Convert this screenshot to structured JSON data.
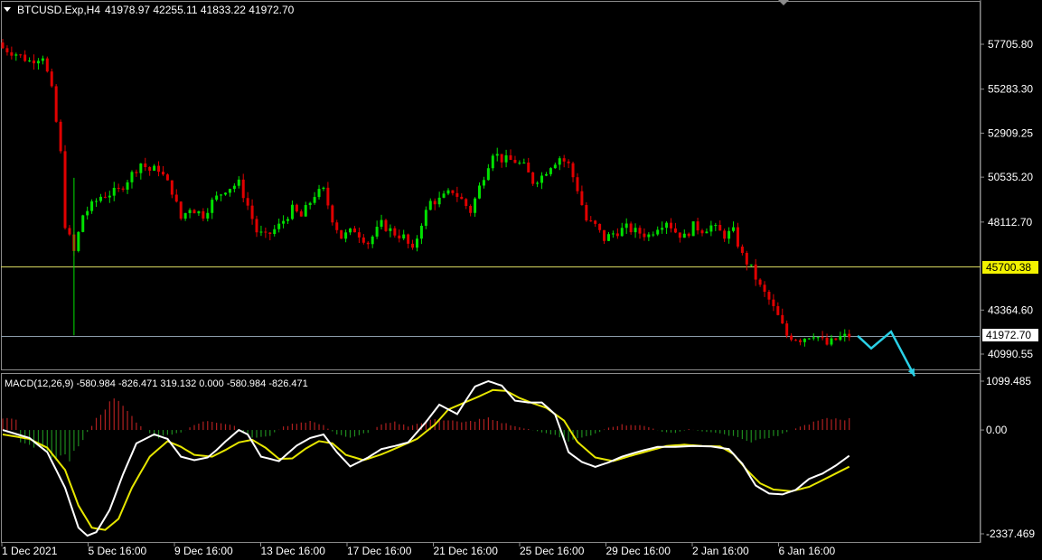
{
  "chart_title": "BTCUSD.Exp,H4",
  "ohlc_text": "41978.97 42255.11 41833.22 41972.70",
  "price_axis": {
    "labels": [
      "57705.80",
      "55283.30",
      "52909.25",
      "50535.20",
      "48112.70",
      "43364.60",
      "40990.55"
    ],
    "values": [
      57705.8,
      55283.3,
      52909.25,
      50535.2,
      48112.7,
      43364.6,
      40990.55
    ]
  },
  "macd": {
    "label": "MACD(12,26,9) -580.984 -826.471 319.132 0.000 -580.984 -826.471",
    "axis_labels": [
      "1099.485",
      "0.00",
      "-2337.469"
    ],
    "axis_values": [
      1099.485,
      0,
      -2337.469
    ]
  },
  "time_axis": [
    "1 Dec 2021",
    "5 Dec 16:00",
    "9 Dec 16:00",
    "13 Dec 16:00",
    "17 Dec 16:00",
    "21 Dec 16:00",
    "25 Dec 16:00",
    "29 Dec 16:00",
    "2 Jan 16:00",
    "6 Jan 16:00"
  ],
  "levels": {
    "support": {
      "label": "45700.38",
      "value": 45700.38,
      "color": "#d8d860"
    },
    "current": {
      "label": "41972.70",
      "value": 41972.7,
      "color": "#8a9aa8"
    }
  },
  "colors": {
    "bull": "#00e000",
    "bear": "#e00000",
    "hist_pos": "#b02020",
    "hist_neg": "#1e8a1e",
    "macd_line": "#ffffff",
    "signal_line": "#e6e600",
    "arrow": "#2ad0e6",
    "frame": "#8c8c8c"
  },
  "icons": {
    "menu": "triangle-down-icon",
    "shift": "chart-shift-icon"
  },
  "chart_data": {
    "type": "candlestick",
    "title": "BTCUSD.Exp,H4",
    "y_range": [
      40300,
      59300
    ],
    "close_path": [
      [
        0,
        57500
      ],
      [
        3,
        57200
      ],
      [
        6,
        56800
      ],
      [
        9,
        57100
      ],
      [
        11,
        55200
      ],
      [
        13,
        51800
      ],
      [
        14,
        48000
      ],
      [
        16,
        46500
      ],
      [
        18,
        48500
      ],
      [
        22,
        49500
      ],
      [
        26,
        49800
      ],
      [
        29,
        50700
      ],
      [
        31,
        51300
      ],
      [
        33,
        50900
      ],
      [
        35,
        51000
      ],
      [
        38,
        49800
      ],
      [
        40,
        48300
      ],
      [
        42,
        48900
      ],
      [
        45,
        48500
      ],
      [
        47,
        49200
      ],
      [
        50,
        49900
      ],
      [
        53,
        50200
      ],
      [
        55,
        49000
      ],
      [
        57,
        47600
      ],
      [
        59,
        47300
      ],
      [
        62,
        47900
      ],
      [
        65,
        48800
      ],
      [
        67,
        48400
      ],
      [
        70,
        49600
      ],
      [
        72,
        49800
      ],
      [
        74,
        48300
      ],
      [
        76,
        47300
      ],
      [
        79,
        47700
      ],
      [
        82,
        47000
      ],
      [
        85,
        48000
      ],
      [
        88,
        47500
      ],
      [
        90,
        47300
      ],
      [
        92,
        46500
      ],
      [
        94,
        48100
      ],
      [
        96,
        49200
      ],
      [
        98,
        49300
      ],
      [
        101,
        49800
      ],
      [
        103,
        49300
      ],
      [
        105,
        48700
      ],
      [
        107,
        50000
      ],
      [
        110,
        51900
      ],
      [
        112,
        51500
      ],
      [
        115,
        51400
      ],
      [
        117,
        51100
      ],
      [
        119,
        50300
      ],
      [
        121,
        50600
      ],
      [
        123,
        51200
      ],
      [
        125,
        51600
      ],
      [
        127,
        51200
      ],
      [
        129,
        49900
      ],
      [
        131,
        48200
      ],
      [
        133,
        47900
      ],
      [
        135,
        47200
      ],
      [
        137,
        47500
      ],
      [
        140,
        47800
      ],
      [
        142,
        47600
      ],
      [
        145,
        47400
      ],
      [
        147,
        47900
      ],
      [
        149,
        48200
      ],
      [
        151,
        47600
      ],
      [
        153,
        47300
      ],
      [
        155,
        47900
      ],
      [
        157,
        47700
      ],
      [
        159,
        47900
      ],
      [
        162,
        47400
      ],
      [
        164,
        47600
      ],
      [
        166,
        46300
      ],
      [
        168,
        45600
      ],
      [
        170,
        44600
      ],
      [
        172,
        43900
      ],
      [
        174,
        43000
      ],
      [
        176,
        42000
      ],
      [
        179,
        41800
      ],
      [
        182,
        42100
      ],
      [
        185,
        41500
      ],
      [
        188,
        41900
      ],
      [
        190,
        41972.7
      ]
    ],
    "forecast_arrow": [
      {
        "x": 0,
        "price": 41972.7
      },
      {
        "x": 1,
        "price": 41300
      },
      {
        "x": 2,
        "price": 42200
      },
      {
        "x": 3,
        "price": 39800
      }
    ],
    "macd_line": [
      [
        0,
        0
      ],
      [
        6,
        -180
      ],
      [
        10,
        -500
      ],
      [
        14,
        -1300
      ],
      [
        17,
        -2200
      ],
      [
        19,
        -2380
      ],
      [
        21,
        -2300
      ],
      [
        24,
        -1800
      ],
      [
        27,
        -1000
      ],
      [
        30,
        -300
      ],
      [
        34,
        -100
      ],
      [
        37,
        -200
      ],
      [
        40,
        -600
      ],
      [
        43,
        -680
      ],
      [
        46,
        -620
      ],
      [
        48,
        -450
      ],
      [
        50,
        -260
      ],
      [
        53,
        0
      ],
      [
        55,
        -100
      ],
      [
        58,
        -600
      ],
      [
        62,
        -700
      ],
      [
        66,
        -350
      ],
      [
        69,
        -180
      ],
      [
        72,
        -100
      ],
      [
        75,
        -500
      ],
      [
        78,
        -820
      ],
      [
        82,
        -620
      ],
      [
        85,
        -430
      ],
      [
        88,
        -360
      ],
      [
        91,
        -280
      ],
      [
        95,
        180
      ],
      [
        98,
        570
      ],
      [
        102,
        360
      ],
      [
        106,
        980
      ],
      [
        109,
        1100
      ],
      [
        112,
        1000
      ],
      [
        115,
        660
      ],
      [
        118,
        620
      ],
      [
        121,
        620
      ],
      [
        124,
        350
      ],
      [
        127,
        -500
      ],
      [
        130,
        -720
      ],
      [
        133,
        -830
      ],
      [
        136,
        -730
      ],
      [
        139,
        -600
      ],
      [
        143,
        -480
      ],
      [
        147,
        -380
      ],
      [
        151,
        -380
      ],
      [
        155,
        -360
      ],
      [
        159,
        -370
      ],
      [
        163,
        -430
      ],
      [
        166,
        -760
      ],
      [
        169,
        -1250
      ],
      [
        172,
        -1430
      ],
      [
        175,
        -1450
      ],
      [
        178,
        -1350
      ],
      [
        181,
        -1100
      ],
      [
        184,
        -980
      ],
      [
        187,
        -800
      ],
      [
        190,
        -580.984
      ]
    ],
    "signal_line": [
      [
        0,
        -100
      ],
      [
        6,
        -200
      ],
      [
        10,
        -400
      ],
      [
        14,
        -900
      ],
      [
        17,
        -1700
      ],
      [
        20,
        -2200
      ],
      [
        23,
        -2250
      ],
      [
        26,
        -2000
      ],
      [
        29,
        -1300
      ],
      [
        33,
        -600
      ],
      [
        37,
        -250
      ],
      [
        40,
        -380
      ],
      [
        43,
        -560
      ],
      [
        47,
        -600
      ],
      [
        50,
        -450
      ],
      [
        53,
        -280
      ],
      [
        56,
        -220
      ],
      [
        59,
        -400
      ],
      [
        62,
        -650
      ],
      [
        65,
        -640
      ],
      [
        68,
        -420
      ],
      [
        71,
        -250
      ],
      [
        74,
        -300
      ],
      [
        77,
        -560
      ],
      [
        81,
        -680
      ],
      [
        85,
        -550
      ],
      [
        89,
        -380
      ],
      [
        93,
        -200
      ],
      [
        97,
        120
      ],
      [
        100,
        460
      ],
      [
        103,
        590
      ],
      [
        107,
        760
      ],
      [
        110,
        900
      ],
      [
        113,
        880
      ],
      [
        116,
        720
      ],
      [
        119,
        600
      ],
      [
        122,
        500
      ],
      [
        126,
        210
      ],
      [
        129,
        -270
      ],
      [
        133,
        -620
      ],
      [
        137,
        -700
      ],
      [
        141,
        -580
      ],
      [
        145,
        -470
      ],
      [
        149,
        -360
      ],
      [
        153,
        -330
      ],
      [
        157,
        -360
      ],
      [
        161,
        -370
      ],
      [
        164,
        -540
      ],
      [
        167,
        -900
      ],
      [
        170,
        -1200
      ],
      [
        173,
        -1340
      ],
      [
        177,
        -1380
      ],
      [
        181,
        -1280
      ],
      [
        185,
        -1080
      ],
      [
        190,
        -826.471
      ]
    ],
    "histogram": [
      [
        4,
        -250
      ],
      [
        8,
        -380
      ],
      [
        12,
        -600
      ],
      [
        15,
        -650
      ],
      [
        18,
        -200
      ],
      [
        21,
        250
      ],
      [
        23,
        520
      ],
      [
        25,
        650
      ],
      [
        27,
        550
      ],
      [
        29,
        300
      ],
      [
        31,
        80
      ],
      [
        33,
        -80
      ],
      [
        35,
        -180
      ],
      [
        37,
        -120
      ],
      [
        40,
        -60
      ],
      [
        43,
        110
      ],
      [
        46,
        210
      ],
      [
        49,
        170
      ],
      [
        52,
        100
      ],
      [
        54,
        -90
      ],
      [
        57,
        -180
      ],
      [
        60,
        -120
      ],
      [
        63,
        70
      ],
      [
        66,
        160
      ],
      [
        69,
        200
      ],
      [
        72,
        100
      ],
      [
        75,
        -100
      ],
      [
        78,
        -160
      ],
      [
        82,
        -60
      ],
      [
        85,
        120
      ],
      [
        88,
        170
      ],
      [
        91,
        90
      ],
      [
        94,
        160
      ],
      [
        97,
        260
      ],
      [
        100,
        230
      ],
      [
        103,
        160
      ],
      [
        106,
        210
      ],
      [
        109,
        260
      ],
      [
        112,
        170
      ],
      [
        115,
        80
      ],
      [
        118,
        20
      ],
      [
        121,
        -50
      ],
      [
        124,
        -120
      ],
      [
        127,
        -260
      ],
      [
        130,
        -150
      ],
      [
        133,
        -90
      ],
      [
        136,
        60
      ],
      [
        139,
        120
      ],
      [
        142,
        110
      ],
      [
        145,
        70
      ],
      [
        148,
        -40
      ],
      [
        151,
        -70
      ],
      [
        154,
        20
      ],
      [
        157,
        -30
      ],
      [
        161,
        -80
      ],
      [
        164,
        -150
      ],
      [
        167,
        -260
      ],
      [
        170,
        -220
      ],
      [
        174,
        -120
      ],
      [
        178,
        40
      ],
      [
        181,
        140
      ],
      [
        184,
        230
      ],
      [
        187,
        260
      ],
      [
        190,
        240
      ]
    ]
  }
}
